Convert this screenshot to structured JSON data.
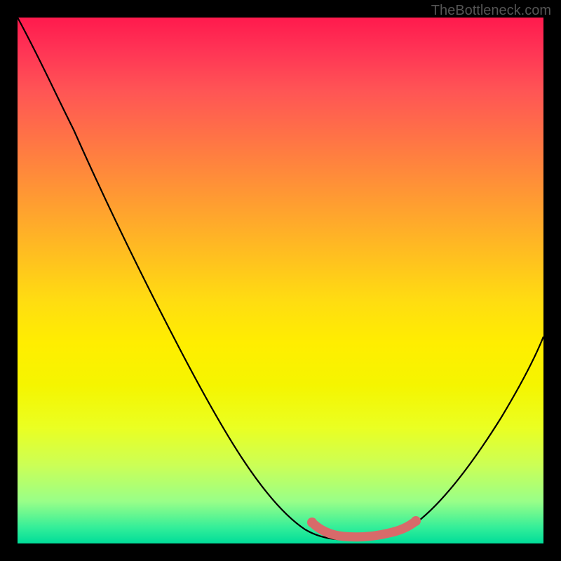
{
  "watermark": "TheBottleneck.com",
  "chart_data": {
    "type": "line",
    "title": "",
    "xlabel": "",
    "ylabel": "",
    "xlim": [
      0,
      100
    ],
    "ylim": [
      0,
      100
    ],
    "series": [
      {
        "name": "bottleneck-curve",
        "x": [
          0,
          6,
          12,
          18,
          24,
          30,
          36,
          42,
          48,
          54,
          58,
          62,
          66,
          70,
          74,
          78,
          82,
          86,
          90,
          94,
          100
        ],
        "y": [
          100,
          92,
          82,
          72,
          62,
          52,
          43,
          33,
          24,
          14,
          7,
          3,
          2,
          2,
          3,
          6,
          12,
          20,
          29,
          39,
          55
        ],
        "color": "#000000"
      },
      {
        "name": "highlight-segment",
        "x": [
          57,
          60,
          63,
          66,
          69,
          72,
          75
        ],
        "y": [
          5,
          3,
          2,
          2,
          2,
          3,
          4
        ],
        "color": "#d86a6a"
      }
    ],
    "gradient_stops": [
      {
        "pos": 0,
        "color": "#ff1a4d"
      },
      {
        "pos": 50,
        "color": "#ffdd00"
      },
      {
        "pos": 100,
        "color": "#00dd99"
      }
    ]
  }
}
